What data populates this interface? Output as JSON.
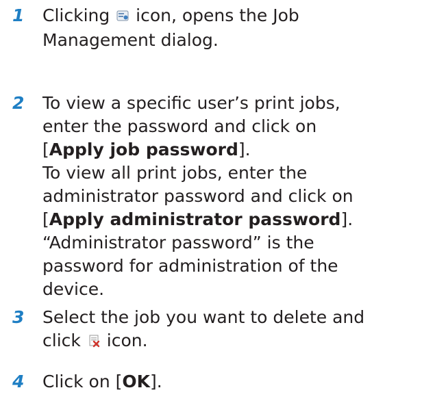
{
  "steps": [
    {
      "number": "1",
      "before_icon": "Clicking ",
      "icon": "job-management-icon",
      "after_icon": " icon, opens the Job",
      "line2": "Management dialog."
    },
    {
      "number": "2",
      "line1": "To view a specific user’s print jobs,",
      "line2": "enter the password and click on",
      "bracket_open": "[",
      "button1": "Apply job password",
      "bracket_close": "].",
      "line4": "To view all print jobs, enter the",
      "line5": "administrator password and click on",
      "button2": "Apply administrator password",
      "line7": "“Administrator password” is the",
      "line8": "password for administration of the",
      "line9": "device."
    },
    {
      "number": "3",
      "line1": "Select the job you want to delete and",
      "before_icon": "click ",
      "icon": "delete-job-icon",
      "after_icon": " icon."
    },
    {
      "number": "4",
      "before": "Click on [",
      "button": "OK",
      "after": "]."
    }
  ],
  "colors": {
    "step_number": "#1f7fc4",
    "text": "#231f20"
  }
}
